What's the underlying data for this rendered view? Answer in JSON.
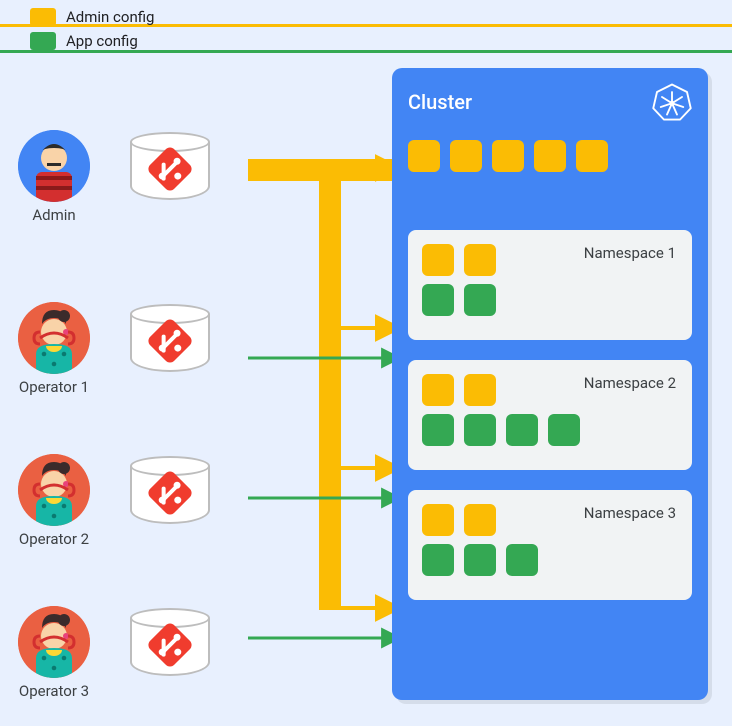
{
  "legend": {
    "admin_label": "Admin config",
    "app_label": "App config",
    "admin_color": "#fbbc04",
    "app_color": "#34a853"
  },
  "actors": {
    "admin": {
      "label": "Admin"
    },
    "operator1": {
      "label": "Operator 1"
    },
    "operator2": {
      "label": "Operator 2"
    },
    "operator3": {
      "label": "Operator 3"
    }
  },
  "cluster": {
    "title": "Cluster",
    "top_box_count": 5,
    "namespaces": [
      {
        "title": "Namespace 1",
        "yellow": 2,
        "green": 2
      },
      {
        "title": "Namespace 2",
        "yellow": 2,
        "green": 4
      },
      {
        "title": "Namespace 3",
        "yellow": 2,
        "green": 3
      }
    ]
  },
  "colors": {
    "cluster_bg": "#4285f4",
    "ns_bg": "#f1f3f4",
    "yellow": "#fbbc04",
    "green": "#34a853",
    "git": "#f03c2e"
  }
}
